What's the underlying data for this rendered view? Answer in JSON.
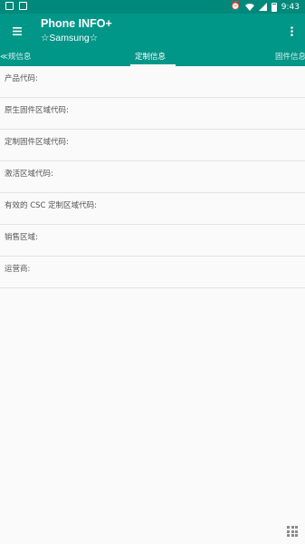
{
  "status_bar": {
    "time": "9:43",
    "icons": [
      "notification-icon",
      "image-icon",
      "alarm-icon",
      "wifi-icon",
      "signal-icon",
      "battery-icon"
    ]
  },
  "toolbar": {
    "title": "Phone INFO+",
    "subtitle": "☆Samsung☆",
    "color": "#009688"
  },
  "tabs": {
    "left": "≪规信息",
    "active": "定制信息",
    "right": "固件信息"
  },
  "fields": [
    {
      "label": "产品代码:"
    },
    {
      "label": "原生固件区域代码:"
    },
    {
      "label": "定制固件区域代码:"
    },
    {
      "label": "激活区域代码:"
    },
    {
      "label": "有效的 CSC 定制区域代码:"
    },
    {
      "label": "销售区域:"
    },
    {
      "label": "运营商:"
    }
  ]
}
